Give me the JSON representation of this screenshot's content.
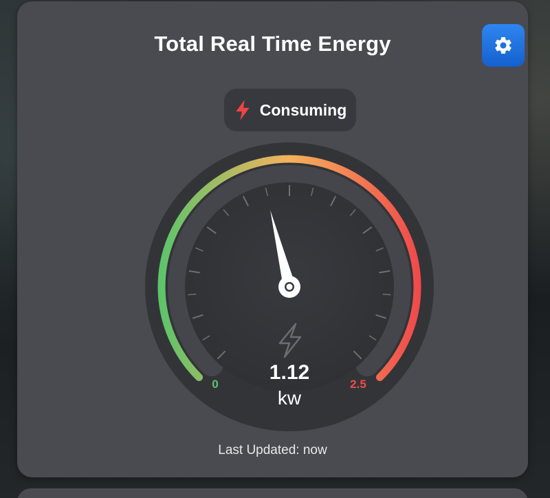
{
  "card": {
    "title": "Total Real Time Energy",
    "settings_icon": "gear-icon",
    "status": {
      "icon": "lightning-bolt-icon",
      "label": "Consuming",
      "icon_color": "#ef4444"
    },
    "gauge": {
      "value": 1.12,
      "value_label": "1.12",
      "unit": "kw",
      "min": 0,
      "max": 2.5,
      "min_label": "0",
      "max_label": "2.5",
      "center_icon": "lightning-bolt-icon",
      "colors": {
        "low": "#5ec46a",
        "mid": "#f5b25c",
        "high": "#f04b4b"
      }
    },
    "footer": "Last Updated: now"
  },
  "colors": {
    "card_bg": "#4a4b51",
    "accent": "#1f6fe0"
  }
}
